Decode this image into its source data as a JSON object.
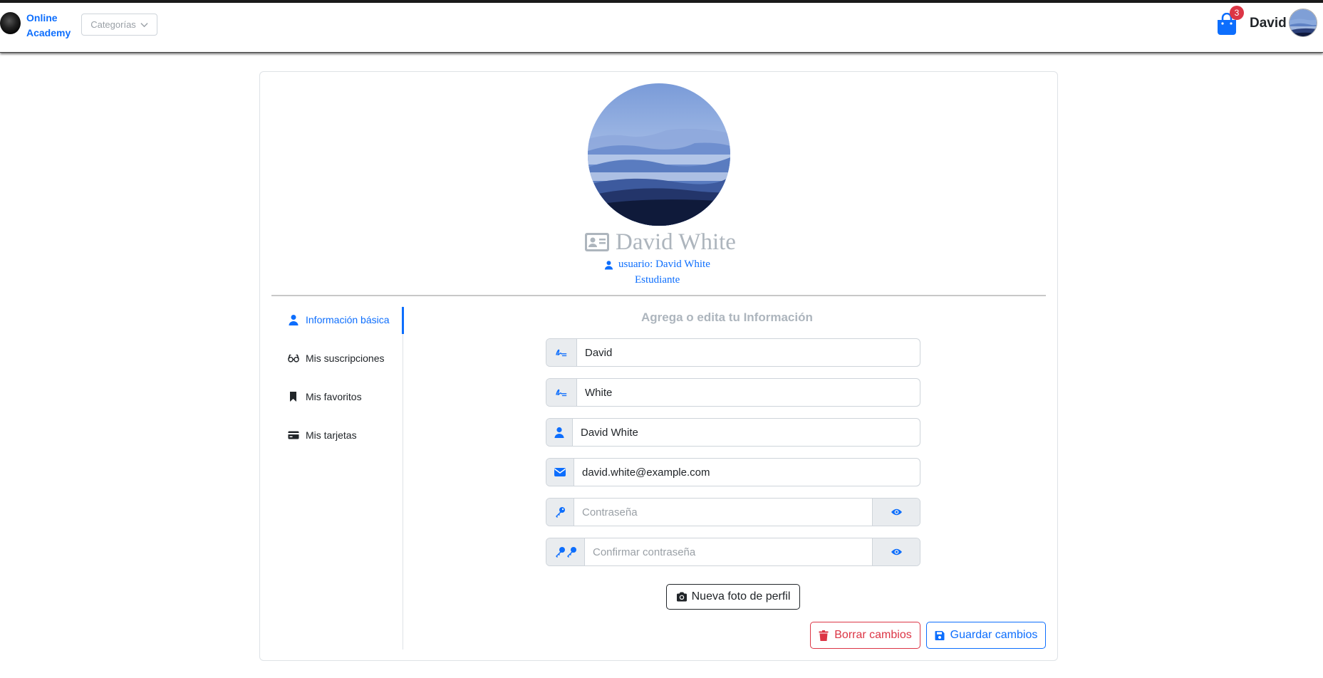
{
  "navbar": {
    "brand": "Online Academy",
    "categories_label": "Categorías",
    "cart_count": "3",
    "user_name": "David",
    "brand_color": "#0d6efd"
  },
  "profile": {
    "full_name": "David White",
    "username_line": "usuario: David White",
    "role": "Estudiante"
  },
  "sidebar": {
    "items": [
      {
        "label": "Información básica",
        "icon": "user-icon",
        "active": true
      },
      {
        "label": "Mis suscripciones",
        "icon": "glasses-icon",
        "active": false
      },
      {
        "label": "Mis favoritos",
        "icon": "bookmark-icon",
        "active": false
      },
      {
        "label": "Mis tarjetas",
        "icon": "credit-card-icon",
        "active": false
      }
    ]
  },
  "form": {
    "title": "Agrega o edita tu Información",
    "first_name": {
      "value": "David",
      "icon": "signature-icon"
    },
    "last_name": {
      "value": "White",
      "icon": "signature-icon"
    },
    "username": {
      "value": "David White",
      "icon": "user-icon"
    },
    "email": {
      "value": "david.white@example.com",
      "icon": "envelope-icon"
    },
    "password": {
      "placeholder": "Contraseña",
      "icon": "key-icon"
    },
    "confirm_password": {
      "placeholder": "Confirmar contraseña",
      "icon": "keys-icon"
    }
  },
  "buttons": {
    "new_photo": "Nueva foto de perfil",
    "discard": "Borrar cambios",
    "save": "Guardar cambios"
  },
  "colors": {
    "primary": "#0d6efd",
    "danger": "#dc3545",
    "muted": "#adb5bd"
  }
}
